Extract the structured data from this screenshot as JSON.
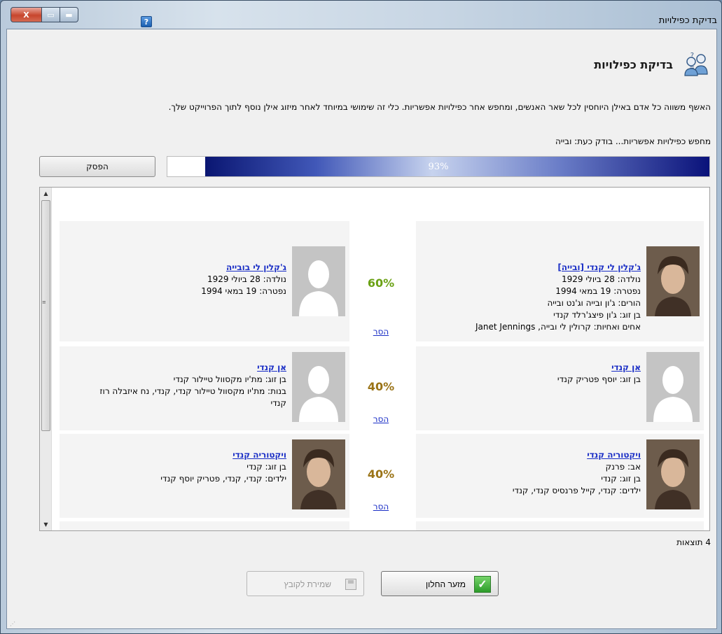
{
  "window": {
    "title": "בדיקת כפילויות",
    "close_glyph": "X",
    "help_glyph": "?"
  },
  "header": {
    "title": "בדיקת כפילויות",
    "icon": "people-question-icon"
  },
  "description": "האשף משווה כל אדם באילן היוחסין לכל שאר האנשים, ומחפש אחר כפילויות אפשריות. כלי זה שימושי במיוחד לאחר מיזוג אילן נוסף לתוך הפרוייקט שלך.",
  "status": "מחפש כפילויות אפשריות... בודק כעת: ובייה",
  "progress": {
    "value": 0.93,
    "label": "93%"
  },
  "stop_button": "הפסק",
  "matches": [
    {
      "left": {
        "name": "ג'קלין לי בובייה",
        "lines": [
          "נולדה: 28 ביולי 1929",
          "נפטרה: 19 במאי 1994"
        ],
        "photo": "silhouette"
      },
      "score": "60%",
      "score_color": "#6aa114",
      "remove": "הסר",
      "right": {
        "name": "ג'קלין לי קנדי [ובייה]",
        "lines": [
          "נולדה: 28 ביולי 1929",
          "נפטרה: 19 במאי 1994",
          "הורים: ג'ון ובייה וג'נט ובייה",
          "בן זוג: ג'ון פיצג'רלד קנדי",
          "אחים ואחיות: קרולין לי ובייה, Janet Jennings"
        ],
        "photo": "portrait"
      }
    },
    {
      "left": {
        "name": "אן קנדי",
        "lines": [
          "בן זוג: מת'יו מקסוול טיילור קנדי",
          "בנות: מת'יו מקסוול טיילור קנדי, קנדי, נח איזבלה רוז",
          "קנדי"
        ],
        "photo": "silhouette"
      },
      "score": "40%",
      "score_color": "#9a7316",
      "remove": "הסר",
      "right": {
        "name": "אן קנדי",
        "lines": [
          "בן זוג: יוסף פטריק קנדי"
        ],
        "photo": "silhouette"
      }
    },
    {
      "left": {
        "name": "ויקטוריה קנדי",
        "lines": [
          "בן זוג: קנדי",
          "ילדים: קנדי, קנדי, פטריק יוסף קנדי"
        ],
        "photo": "portrait"
      },
      "score": "40%",
      "score_color": "#9a7316",
      "remove": "הסר",
      "right": {
        "name": "ויקטוריה קנדי",
        "lines": [
          "אב: פרנק",
          "בן זוג: קנדי",
          "ילדים: קנדי, קייל פרנסיס קנדי, קנדי"
        ],
        "photo": "portrait"
      }
    }
  ],
  "result_count": "4 תוצאות",
  "buttons": {
    "close": "מזער החלון",
    "save": "שמירת לקובץ"
  }
}
